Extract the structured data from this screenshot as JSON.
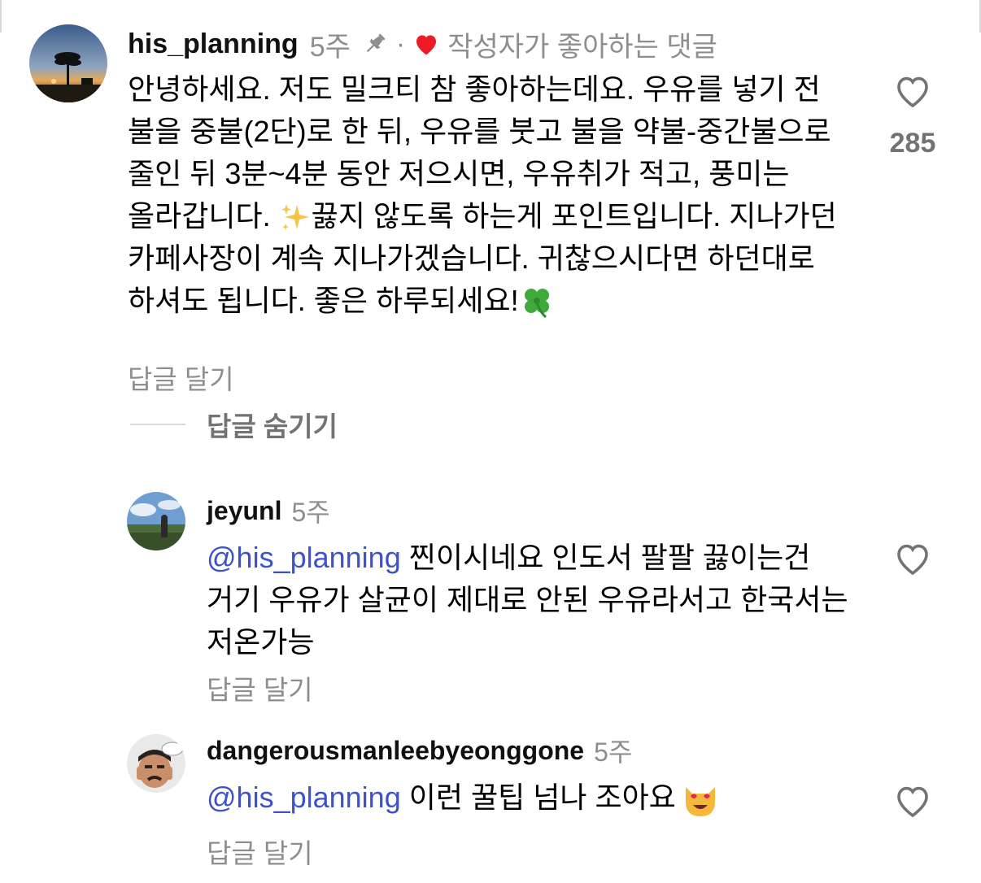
{
  "comments": [
    {
      "username": "his_planning",
      "time": "5주",
      "separator": "·",
      "creator_liked": "작성자가 좋아하는 댓글",
      "text": "안녕하세요. 저도 밀크티 참 좋아하는데요. 우유를 넣기 전 불을 중불(2단)로 한 뒤, 우유를 붓고 불을 약불-중간불으로 줄인 뒤 3분~4분 동안 저으시면, 우유취가 적고, 풍미는 올라갑니다. ",
      "text_2": "끓지 않도록 하는게 포인트입니다. 지나가던 카페사장이 계속 지나가겠습니다. 귀찮으시다면 하던대로 하셔도 됩니다. 좋은 하루되세요!",
      "reply_label": "답글 달기",
      "like_count": "285",
      "hide_replies_label": "답글 숨기기"
    }
  ],
  "replies": [
    {
      "username": "jeyunl",
      "time": "5주",
      "mention": "@his_planning",
      "text": " 찐이시네요  인도서 팔팔 끓이는건 거기 우유가 살균이 제대로 안된 우유라서고 한국서는  저온가능",
      "reply_label": "답글 달기"
    },
    {
      "username": "dangerousmanleebyeonggone",
      "time": "5주",
      "mention": "@his_planning",
      "text": " 이런 꿀팁 넘나 조아요",
      "reply_label": "답글 달기"
    }
  ],
  "colors": {
    "mention": "#3c52c9",
    "meta": "#8e8e8e",
    "liked_heart": "#ed1c24"
  }
}
